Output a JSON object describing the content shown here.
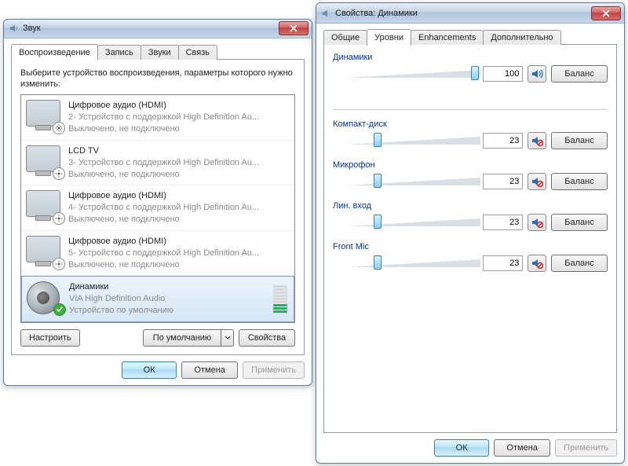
{
  "sound_window": {
    "title": "Звук",
    "tabs": [
      "Воспроизведение",
      "Запись",
      "Звуки",
      "Связь"
    ],
    "active_tab": 0,
    "instruction": "Выберите устройство воспроизведения, параметры которого нужно изменить:",
    "devices": [
      {
        "name": "Цифровое аудио (HDMI)",
        "line2": "2- Устройство с поддержкой High Definition Au...",
        "status": "Выключено, не подключено",
        "icon": "monitor",
        "badge": "disabled"
      },
      {
        "name": "LCD TV",
        "line2": "3- Устройство с поддержкой High Definition Au...",
        "status": "Выключено, не подключено",
        "icon": "monitor",
        "badge": "disabled"
      },
      {
        "name": "Цифровое аудио (HDMI)",
        "line2": "4- Устройство с поддержкой High Definition Au...",
        "status": "Выключено, не подключено",
        "icon": "monitor",
        "badge": "disabled"
      },
      {
        "name": "Цифровое аудио (HDMI)",
        "line2": "5- Устройство с поддержкой High Definition Au...",
        "status": "Выключено, не подключено",
        "icon": "monitor",
        "badge": "disabled"
      },
      {
        "name": "Динамики",
        "line2": "VIA High Definition Audio",
        "status": "Устройство по умолчанию",
        "icon": "speaker",
        "badge": "default",
        "selected": true
      }
    ],
    "buttons": {
      "configure": "Настроить",
      "default": "По умолчанию",
      "properties": "Свойства"
    },
    "footer": {
      "ok": "ОК",
      "cancel": "Отмена",
      "apply": "Применить"
    }
  },
  "props_window": {
    "title": "Свойства: Динамики",
    "tabs": [
      "Общие",
      "Уровни",
      "Enhancements",
      "Дополнительно"
    ],
    "active_tab": 1,
    "channels": [
      {
        "label": "Динамики",
        "value": 100,
        "muted": false
      },
      {
        "label": "Компакт-диск",
        "value": 23,
        "muted": true
      },
      {
        "label": "Микрофон",
        "value": 23,
        "muted": true
      },
      {
        "label": "Лин. вход",
        "value": 23,
        "muted": true
      },
      {
        "label": "Front Mic",
        "value": 23,
        "muted": true
      }
    ],
    "balance_label": "Баланс",
    "footer": {
      "ok": "ОК",
      "cancel": "Отмена",
      "apply": "Применить"
    }
  }
}
